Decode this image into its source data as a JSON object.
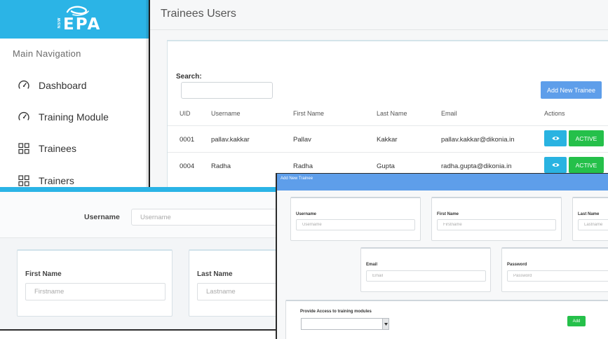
{
  "sidebar": {
    "logo": {
      "small_text": "NSW",
      "main_text": "EPA"
    },
    "nav_heading": "Main Navigation",
    "items": [
      {
        "label": "Dashboard",
        "icon": "speedometer-icon"
      },
      {
        "label": "Training Module",
        "icon": "speedometer-icon"
      },
      {
        "label": "Trainees",
        "icon": "grid-icon"
      },
      {
        "label": "Trainers",
        "icon": "grid-icon"
      }
    ]
  },
  "trainees_users": {
    "title": "Trainees Users",
    "search_label": "Search:",
    "add_button": "Add New Trainee",
    "columns": [
      "UID",
      "Username",
      "First Name",
      "Last Name",
      "Email",
      "Actions"
    ],
    "rows": [
      {
        "uid": "0001",
        "username": "pallav.kakkar",
        "first_name": "Pallav",
        "last_name": "Kakkar",
        "email": "pallav.kakkar@dikonia.in",
        "status": "ACTIVE"
      },
      {
        "uid": "0004",
        "username": "Radha",
        "first_name": "Radha",
        "last_name": "Gupta",
        "email": "radha.gupta@dikonia.in",
        "status": "ACTIVE"
      }
    ]
  },
  "bottom_form": {
    "username_label": "Username",
    "username_placeholder": "Username",
    "first_name_label": "First Name",
    "first_name_placeholder": "Firstname",
    "last_name_label": "Last Name",
    "last_name_placeholder": "Lastname"
  },
  "add_trainee": {
    "title": "Add New Trainee",
    "username_label": "Username",
    "username_placeholder": "Username",
    "first_name_label": "First Name",
    "first_name_placeholder": "Firstname",
    "last_name_label": "Last Name",
    "last_name_placeholder": "Lastname",
    "email_label": "Email",
    "email_placeholder": "Email",
    "password_label": "Password",
    "password_placeholder": "Password",
    "modules_label": "Provide Access to training modules",
    "modules_selected": "",
    "add_button": "Add"
  },
  "colors": {
    "brand_blue": "#2bb4e6",
    "primary_button": "#5e9eea",
    "info_button": "#29b3e1",
    "success_button": "#25c04a"
  }
}
